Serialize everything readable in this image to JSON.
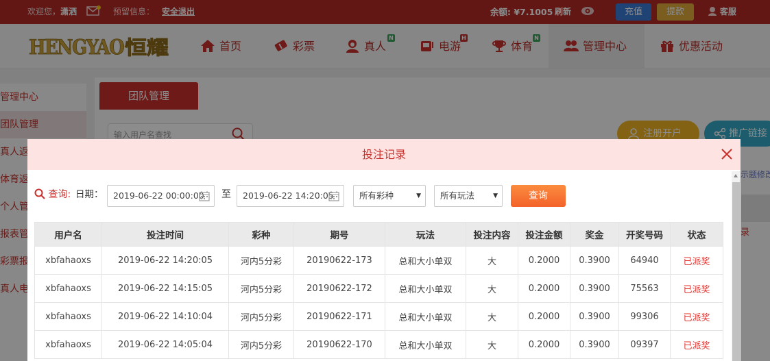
{
  "topbar": {
    "welcome": "欢迎您，",
    "username": "潇洒",
    "warning_label": "预留信息：",
    "logout": "安全退出",
    "balance_label": "余额: ¥7.1005",
    "refresh": "刷新",
    "deposit": "充值",
    "withdraw": "提款",
    "service": "客服"
  },
  "logo": {
    "text": "HENGYAO",
    "cn": "恒耀"
  },
  "nav": [
    {
      "label": "首页",
      "icon": "home-icon",
      "badge": ""
    },
    {
      "label": "彩票",
      "icon": "ticket-icon",
      "badge": ""
    },
    {
      "label": "真人",
      "icon": "dealer-icon",
      "badge": "N"
    },
    {
      "label": "电游",
      "icon": "slot-icon",
      "badge": "H"
    },
    {
      "label": "体育",
      "icon": "trophy-icon",
      "badge": "N"
    },
    {
      "label": "管理中心",
      "icon": "users-icon",
      "badge": ""
    },
    {
      "label": "优惠活动",
      "icon": "gift-icon",
      "badge": ""
    }
  ],
  "sidebar": [
    "管理中心",
    "团队管理",
    "真人返",
    "体育返",
    "个人管",
    "报表管",
    "彩票报",
    "真人电"
  ],
  "page": {
    "tab": "团队管理",
    "search_placeholder": "输入用户名查找",
    "register_btn": "注册开户",
    "promo_btn": "推广链接",
    "right_hint": "示题修改",
    "right_link": "录"
  },
  "modal": {
    "title": "投注记录",
    "query_label": "查询:",
    "date_label": "日期：",
    "start_date": "2019-06-22 00:00:00",
    "to": "至",
    "end_date": "2019-06-22 14:20:05",
    "lottery_select": "所有彩种",
    "play_select": "所有玩法",
    "query_btn": "查询",
    "headers": [
      "用户名",
      "投注时间",
      "彩种",
      "期号",
      "玩法",
      "投注内容",
      "投注金额",
      "奖金",
      "开奖号码",
      "状态"
    ],
    "rows": [
      [
        "xbfahaoxs",
        "2019-06-22 14:20:05",
        "河内5分彩",
        "20190622-173",
        "总和大小单双",
        "大",
        "0.2000",
        "0.3900",
        "64940",
        "已派奖"
      ],
      [
        "xbfahaoxs",
        "2019-06-22 14:15:05",
        "河内5分彩",
        "20190622-172",
        "总和大小单双",
        "大",
        "0.2000",
        "0.3900",
        "75563",
        "已派奖"
      ],
      [
        "xbfahaoxs",
        "2019-06-22 14:10:04",
        "河内5分彩",
        "20190622-171",
        "总和大小单双",
        "大",
        "0.2000",
        "0.3900",
        "99306",
        "已派奖"
      ],
      [
        "xbfahaoxs",
        "2019-06-22 14:05:04",
        "河内5分彩",
        "20190622-170",
        "总和大小单双",
        "大",
        "0.2000",
        "0.3900",
        "09397",
        "已派奖"
      ]
    ]
  },
  "colors": {
    "brand_red": "#b32a25",
    "status_red": "#e0312d",
    "gold": "#c8a03a"
  }
}
